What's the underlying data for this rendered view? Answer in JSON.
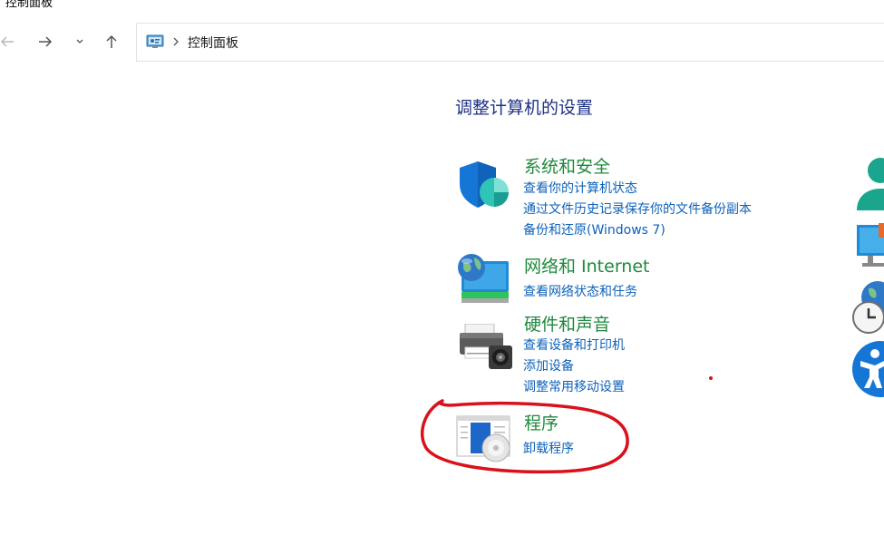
{
  "window": {
    "title": "控制面板"
  },
  "nav": {
    "back_icon": "arrow-left-icon",
    "forward_icon": "arrow-right-icon",
    "recent_icon": "chevron-down-icon",
    "up_icon": "arrow-up-icon"
  },
  "address": {
    "icon": "control-panel-icon",
    "separator_icon": "chevron-right-icon",
    "path": "控制面板"
  },
  "main": {
    "title": "调整计算机的设置",
    "categories": [
      {
        "title": "系统和安全",
        "icon": "shield-icon",
        "links": [
          "查看你的计算机状态",
          "通过文件历史记录保存你的文件备份副本",
          "备份和还原(Windows 7)"
        ]
      },
      {
        "title": "网络和 Internet",
        "icon": "network-globe-icon",
        "links": [
          "查看网络状态和任务"
        ]
      },
      {
        "title": "硬件和声音",
        "icon": "printer-speaker-icon",
        "links": [
          "查看设备和打印机",
          "添加设备",
          "调整常用移动设置"
        ]
      },
      {
        "title": "程序",
        "icon": "programs-disc-icon",
        "links": [
          "卸载程序"
        ]
      }
    ],
    "right_icons": [
      "user-accounts-icon",
      "appearance-monitor-icon",
      "clock-globe-icon",
      "ease-of-access-icon"
    ]
  },
  "colors": {
    "title": "#1e3287",
    "category": "#1e8a3c",
    "link": "#0d62ba",
    "annotation": "#d9111b"
  }
}
